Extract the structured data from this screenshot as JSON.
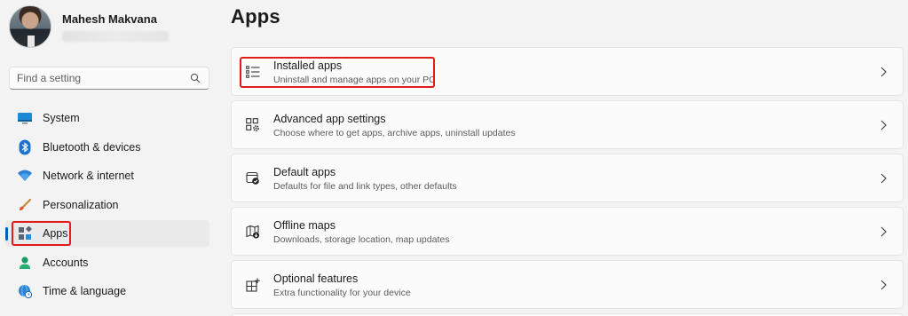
{
  "profile": {
    "name": "Mahesh Makvana"
  },
  "search": {
    "placeholder": "Find a setting"
  },
  "nav": {
    "items": [
      {
        "label": "System",
        "icon": "system-icon"
      },
      {
        "label": "Bluetooth & devices",
        "icon": "bluetooth-icon"
      },
      {
        "label": "Network & internet",
        "icon": "network-icon"
      },
      {
        "label": "Personalization",
        "icon": "brush-icon"
      },
      {
        "label": "Apps",
        "icon": "apps-icon",
        "selected": true
      },
      {
        "label": "Accounts",
        "icon": "accounts-icon"
      },
      {
        "label": "Time & language",
        "icon": "globe-clock-icon"
      }
    ]
  },
  "page": {
    "title": "Apps"
  },
  "cards": [
    {
      "title": "Installed apps",
      "desc": "Uninstall and manage apps on your PC",
      "icon": "list-icon"
    },
    {
      "title": "Advanced app settings",
      "desc": "Choose where to get apps, archive apps, uninstall updates",
      "icon": "app-gear-icon"
    },
    {
      "title": "Default apps",
      "desc": "Defaults for file and link types, other defaults",
      "icon": "default-apps-icon"
    },
    {
      "title": "Offline maps",
      "desc": "Downloads, storage location, map updates",
      "icon": "map-icon"
    },
    {
      "title": "Optional features",
      "desc": "Extra functionality for your device",
      "icon": "optional-features-icon"
    }
  ],
  "colors": {
    "accent": "#005fb8",
    "highlight": "#e21b1b",
    "background": "#f3f3f3",
    "card": "#fbfbfb"
  }
}
